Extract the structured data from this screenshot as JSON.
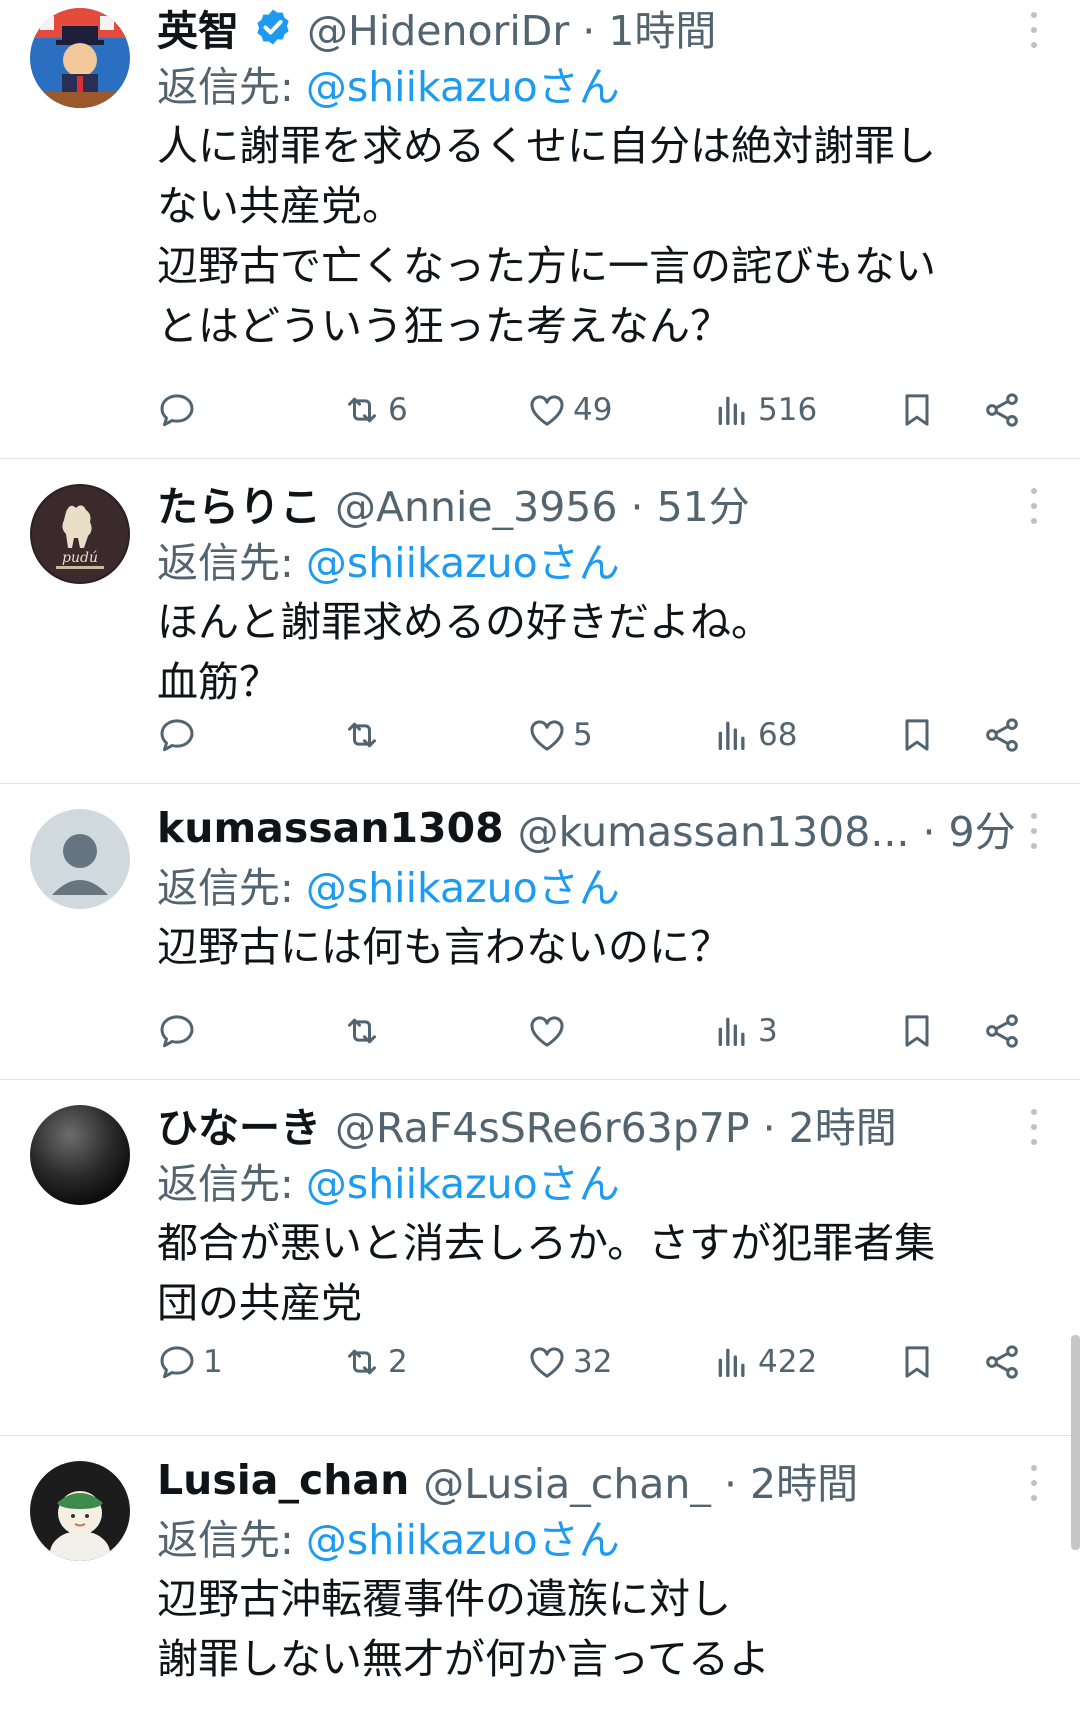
{
  "reply_label": "返信先:",
  "colors": {
    "link": "#1d9bf0",
    "secondary": "#536471",
    "text": "#0f1419",
    "verified": "#1d9bf0"
  },
  "tweets": [
    {
      "display_name": "英智",
      "verified": true,
      "meta": "@HidenoriDr · 1時間",
      "reply_to": "@shiikazuoさん",
      "lines": [
        "人に謝罪を求めるくせに自分は絶対謝罪し",
        "ない共産党。",
        "辺野古で亡くなった方に一言の詫びもない",
        "とはどういう狂った考えなん？"
      ],
      "counts": {
        "reply": "",
        "retweet": "6",
        "like": "49",
        "views": "516"
      }
    },
    {
      "display_name": "たらりこ",
      "verified": false,
      "meta": "@Annie_3956 · 51分",
      "reply_to": "@shiikazuoさん",
      "lines": [
        "ほんと謝罪求めるの好きだよね。",
        "血筋？"
      ],
      "counts": {
        "reply": "",
        "retweet": "",
        "like": "5",
        "views": "68"
      }
    },
    {
      "display_name": "kumassan1308",
      "verified": false,
      "meta": "@kumassan1308... · 9分",
      "reply_to": "@shiikazuoさん",
      "lines": [
        "辺野古には何も言わないのに？"
      ],
      "counts": {
        "reply": "",
        "retweet": "",
        "like": "",
        "views": "3"
      }
    },
    {
      "display_name": "ひなーき",
      "verified": false,
      "meta": "@RaF4sSRe6r63p7P · 2時間",
      "reply_to": "@shiikazuoさん",
      "lines": [
        "都合が悪いと消去しろか。さすが犯罪者集",
        "団の共産党"
      ],
      "counts": {
        "reply": "1",
        "retweet": "2",
        "like": "32",
        "views": "422"
      }
    },
    {
      "display_name": "Lusia_chan",
      "verified": false,
      "meta": "@Lusia_chan_ · 2時間",
      "reply_to": "@shiikazuoさん",
      "lines": [
        "辺野古沖転覆事件の遺族に対し",
        "謝罪しない無才が何か言ってるよ"
      ],
      "counts": {
        "reply": "",
        "retweet": "",
        "like": "",
        "views": ""
      }
    }
  ]
}
